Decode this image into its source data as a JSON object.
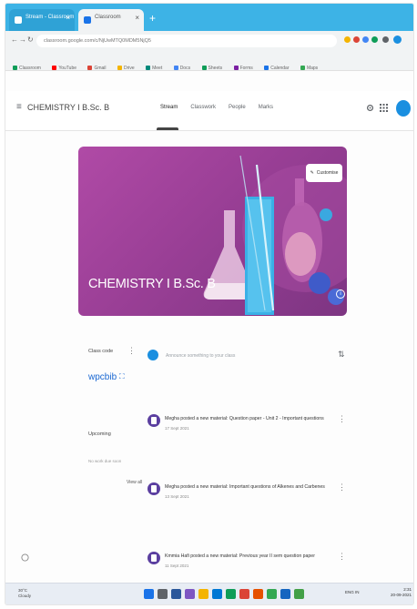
{
  "browser": {
    "tabs": [
      {
        "label": "Stream - Classroom"
      },
      {
        "label": "Classroom"
      }
    ],
    "new_tab": "+",
    "close_glyph": "×",
    "back_glyph": "←",
    "forward_glyph": "→",
    "reload_glyph": "↻",
    "url": "classroom.google.com/c/NjUwMTQ0MDM5NjQ5",
    "bookmarks": [
      "Classroom",
      "YouTube",
      "Gmail",
      "Drive",
      "Meet",
      "Docs",
      "Sheets",
      "Forms",
      "Calendar",
      "Maps"
    ]
  },
  "header": {
    "menu_glyph": "≡",
    "class_name": "CHEMISTRY I B.Sc. B",
    "tabs": [
      "Stream",
      "Classwork",
      "People",
      "Marks"
    ],
    "active_tab": "Stream"
  },
  "banner": {
    "title": "CHEMISTRY I B.Sc. B",
    "customize_label": "Customise",
    "customize_glyph": "✎",
    "info_glyph": "i"
  },
  "sidebar": {
    "class_code_label": "Class code",
    "class_code": "wpcbib",
    "upcoming_label": "Upcoming",
    "no_work_text": "No work due soon",
    "view_all": "View all",
    "kebab_glyph": "⋮",
    "fullscreen_glyph": "⛶"
  },
  "stream": {
    "announce_placeholder": "Announce something to your class",
    "repost_glyph": "⇅",
    "posts": [
      {
        "text": "Megha posted a new material: Question paper - Unit 2 - Important questions",
        "date": "17 Sept 2021"
      },
      {
        "text": "Megha posted a new material: Important questions of Alkenes and Carbenes",
        "date": "13 Sept 2021"
      },
      {
        "text": "Kmmia Hafi posted a new material: Previous year II sem question paper",
        "date": "11 Sept 2021"
      }
    ]
  },
  "taskbar": {
    "weather_temp": "30°C",
    "weather_desc": "Cloudy",
    "tray": "ENG IN",
    "time": "2:31",
    "date": "20-09-2021"
  },
  "colors": {
    "tabstrip": "#3db3e6",
    "banner": "#9a3f96",
    "accent": "#1a8fe0",
    "post_icon": "#5b3fa0",
    "class_code": "#1967d2"
  }
}
